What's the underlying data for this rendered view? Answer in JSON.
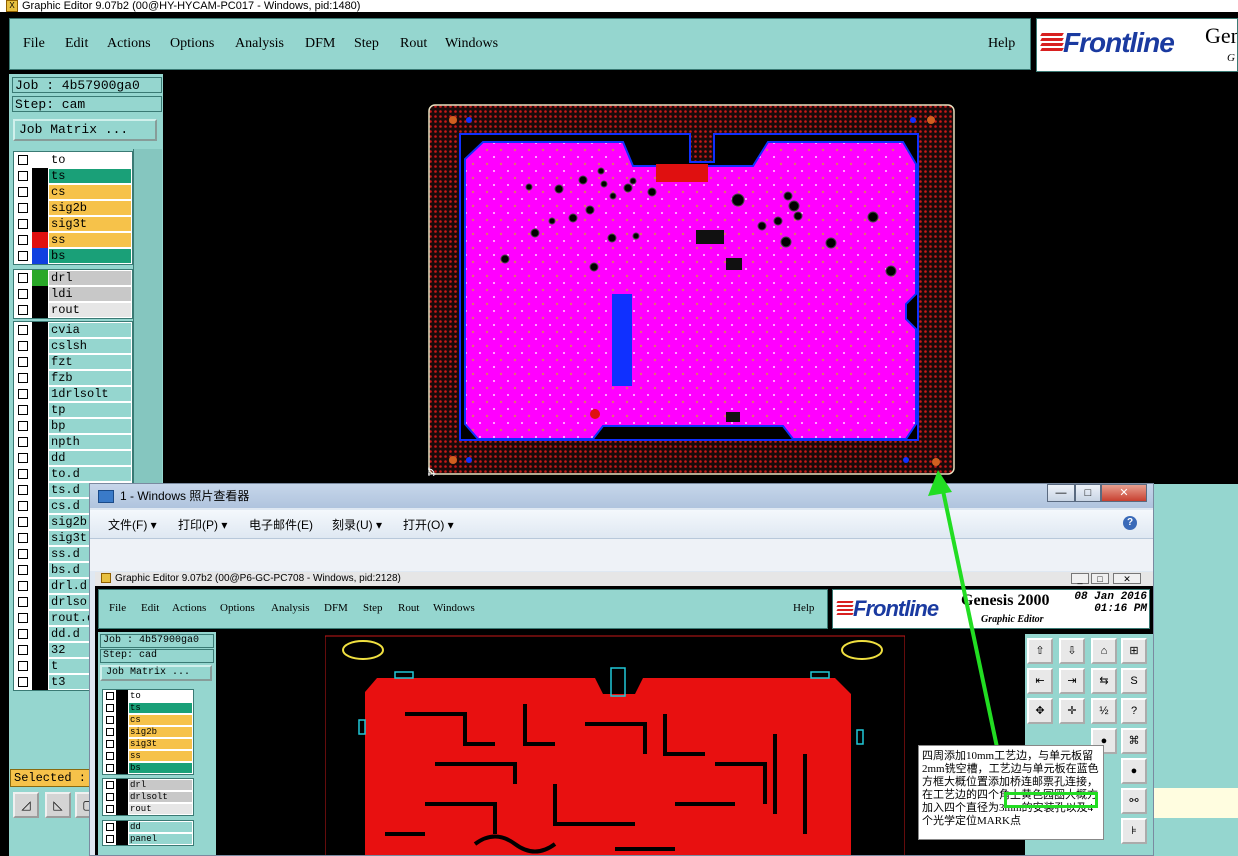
{
  "window": {
    "title": "Graphic Editor 9.07b2 (00@HY-HYCAM-PC017 - Windows, pid:1480)"
  },
  "menubar": {
    "items": [
      "File",
      "Edit",
      "Actions",
      "Options",
      "Analysis",
      "DFM",
      "Step",
      "Rout",
      "Windows"
    ],
    "help": "Help"
  },
  "logo": {
    "brand": "Frontline",
    "product": "Gen",
    "sub": "G"
  },
  "left": {
    "job": "Job : 4b57900ga0",
    "step": "Step: cam",
    "job_matrix": "Job Matrix ...",
    "selected": "Selected :",
    "layers_group1": [
      {
        "name": "to",
        "color": "#ffffff",
        "chk": "#ffffff",
        "edit": true
      },
      {
        "name": "ts",
        "color": "#1aa078",
        "chk": "#000000"
      },
      {
        "name": "cs",
        "color": "#f6c24a",
        "chk": "#000000"
      },
      {
        "name": "sig2b",
        "color": "#f6c24a",
        "chk": "#000000"
      },
      {
        "name": "sig3t",
        "color": "#f6c24a",
        "chk": "#000000"
      },
      {
        "name": "ss",
        "color": "#f6c24a",
        "chk": "#e01010"
      },
      {
        "name": "bs",
        "color": "#1aa078",
        "chk": "#1040e0"
      }
    ],
    "layers_group2": [
      {
        "name": "drl",
        "color": "#c8c8c8",
        "chk": "#2aa828"
      },
      {
        "name": "ldi",
        "color": "#c8c8c8",
        "chk": "#000000"
      },
      {
        "name": "rout",
        "color": "#e6e6e6",
        "chk": "#000000"
      }
    ],
    "layers_group3": [
      {
        "name": "cvia",
        "color": "#95d6cf"
      },
      {
        "name": "cslsh",
        "color": "#95d6cf"
      },
      {
        "name": "fzt",
        "color": "#95d6cf"
      },
      {
        "name": "fzb",
        "color": "#95d6cf"
      },
      {
        "name": "1drlsolt",
        "color": "#95d6cf"
      },
      {
        "name": "tp",
        "color": "#95d6cf"
      },
      {
        "name": "bp",
        "color": "#95d6cf"
      },
      {
        "name": "npth",
        "color": "#95d6cf"
      },
      {
        "name": "dd",
        "color": "#95d6cf"
      },
      {
        "name": "to.d",
        "color": "#95d6cf"
      },
      {
        "name": "ts.d",
        "color": "#95d6cf"
      },
      {
        "name": "cs.d",
        "color": "#95d6cf"
      },
      {
        "name": "sig2b",
        "color": "#95d6cf"
      },
      {
        "name": "sig3t",
        "color": "#95d6cf"
      },
      {
        "name": "ss.d",
        "color": "#95d6cf"
      },
      {
        "name": "bs.d",
        "color": "#95d6cf"
      },
      {
        "name": "drl.d",
        "color": "#95d6cf"
      },
      {
        "name": "drlso",
        "color": "#95d6cf"
      },
      {
        "name": "rout.d",
        "color": "#95d6cf"
      },
      {
        "name": "dd.d",
        "color": "#95d6cf"
      },
      {
        "name": "32",
        "color": "#95d6cf"
      },
      {
        "name": "t",
        "color": "#95d6cf"
      },
      {
        "name": "t3",
        "color": "#95d6cf"
      }
    ]
  },
  "viewer": {
    "title": "1 - Windows 照片查看器",
    "menu": [
      "文件(F)",
      "打印(P)",
      "电子邮件(E)",
      "刻录(U)",
      "打开(O)"
    ],
    "help": "?",
    "btn_min": "—",
    "btn_max": "□",
    "btn_close": "✕"
  },
  "inner": {
    "title": "Graphic Editor 9.07b2 (00@P6-GC-PC708 - Windows, pid:2128)",
    "menu": [
      "File",
      "Edit",
      "Actions",
      "Options",
      "Analysis",
      "DFM",
      "Step",
      "Rout",
      "Windows"
    ],
    "help": "Help",
    "brand": "Frontline",
    "product": "Genesis 2000",
    "product_sub": "Graphic Editor",
    "date": "08 Jan 2016",
    "time": "01:16 PM",
    "job": "Job : 4b57900ga0",
    "step": "Step: cad",
    "job_matrix": "Job Matrix ...",
    "layers_group1": [
      {
        "name": "to",
        "color": "#ffffff"
      },
      {
        "name": "ts",
        "color": "#1aa078"
      },
      {
        "name": "cs",
        "color": "#f6c24a"
      },
      {
        "name": "sig2b",
        "color": "#f6c24a"
      },
      {
        "name": "sig3t",
        "color": "#f6c24a"
      },
      {
        "name": "ss",
        "color": "#f6c24a"
      },
      {
        "name": "bs",
        "color": "#1aa078"
      }
    ],
    "layers_group2": [
      {
        "name": "drl",
        "color": "#c8c8c8"
      },
      {
        "name": "drlsolt",
        "color": "#c8c8c8"
      },
      {
        "name": "rout",
        "color": "#e6e6e6"
      }
    ],
    "layers_group3": [
      {
        "name": "dd",
        "color": "#95d6cf"
      },
      {
        "name": "panel",
        "color": "#95d6cf"
      }
    ]
  },
  "note": {
    "text": "四周添加10mm工艺边，与单元板留2mm铣空槽，工艺边与单元板在蓝色方框大概位置添加桥连邮票孔连接，在工艺边的四个角上黄色园圈大概方加入四个直径为3mm的安装孔以及4个光学定位MARK点"
  },
  "colors": {
    "panel": "#95d6cf",
    "board_magenta": "#ff00ff",
    "board_dots": "#c81818",
    "blue_outline": "#1030ff",
    "arrow": "#22dd22"
  }
}
